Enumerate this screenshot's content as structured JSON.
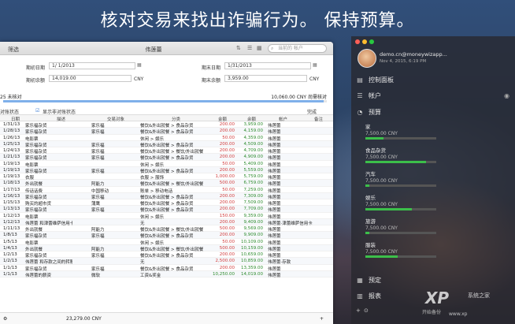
{
  "headline": "核对交易来找出诈骗行为。 保持预算。",
  "window": {
    "filter_label": "筛选",
    "title": "伟莲蕾",
    "search_placeholder": "当前的 帐户",
    "form": {
      "start_date_label": "期初日期",
      "start_date": "1/ 1/2013",
      "end_date_label": "期末日期",
      "end_date": "1/31/2013",
      "opening_balance_label": "期初余额",
      "opening_balance": "14,019.00",
      "opening_currency": "CNY",
      "closing_balance_label": "期末余额",
      "closing_balance": "3,959.00",
      "closing_currency": "CNY"
    },
    "progress": {
      "left_text": "25 未核对",
      "right_text": "10,060.00 CNY 尚需核对",
      "fraction": 0.99
    },
    "filter_row": {
      "left": "对账状态",
      "option": "显示非对账状态",
      "done": "完成"
    },
    "columns": [
      "日期",
      "描述",
      "交易对象",
      "分类",
      "金额",
      "余额",
      "帐户",
      "备注"
    ],
    "rows": [
      [
        "1/31/13",
        "家乐福杂货",
        "家乐福",
        "餐饮&外出就餐 > 食品杂货",
        "200.00",
        "3,959.00",
        "伟莲蕾",
        ""
      ],
      [
        "1/28/13",
        "家乐福杂货",
        "家乐福",
        "餐饮&外出就餐 > 食品杂货",
        "200.00",
        "4,159.00",
        "伟莲蕾",
        ""
      ],
      [
        "1/26/13",
        "电影票",
        "",
        "休闲 > 娱乐",
        "50.00",
        "4,359.00",
        "伟莲蕾",
        ""
      ],
      [
        "1/25/13",
        "家乐福杂货",
        "家乐福",
        "餐饮&外出就餐 > 食品杂货",
        "200.00",
        "4,509.00",
        "伟莲蕾",
        ""
      ],
      [
        "1/24/13",
        "家乐福杂货",
        "家乐福",
        "餐饮&外出就餐 > 餐饮/外出就餐",
        "200.00",
        "4,709.00",
        "伟莲蕾",
        ""
      ],
      [
        "1/21/13",
        "家乐福杂货",
        "家乐福",
        "餐饮&外出就餐 > 食品杂货",
        "200.00",
        "4,909.00",
        "伟莲蕾",
        ""
      ],
      [
        "1/19/13",
        "电影票",
        "",
        "休闲 > 娱乐",
        "50.00",
        "5,409.00",
        "伟莲蕾",
        ""
      ],
      [
        "1/19/13",
        "家乐福杂货",
        "家乐福",
        "餐饮&外出就餐 > 食品杂货",
        "200.00",
        "5,559.00",
        "伟莲蕾",
        ""
      ],
      [
        "1/19/13",
        "衣服",
        "",
        "衣服 > 服饰",
        "1,000.00",
        "5,759.00",
        "伟莲蕾",
        ""
      ],
      [
        "1/18/13",
        "外出就餐",
        "阿能力",
        "餐饮&外出就餐 > 餐饮/外出就餐",
        "500.00",
        "6,759.00",
        "伟莲蕾",
        ""
      ],
      [
        "1/17/13",
        "传话话费",
        "中国移动",
        "账单 > 移动电话",
        "50.00",
        "7,259.00",
        "伟莲蕾",
        ""
      ],
      [
        "1/16/13",
        "家乐福杂货",
        "家乐福",
        "餐饮&外出就餐 > 食品杂货",
        "200.00",
        "7,309.00",
        "伟莲蕾",
        ""
      ],
      [
        "1/15/13",
        "购买的超市货",
        "蒲鹰",
        "餐饮&外出就餐 > 食品杂货",
        "200.00",
        "7,509.00",
        "伟莲蕾",
        ""
      ],
      [
        "1/13/13",
        "家乐福杂货",
        "家乐福",
        "餐饮&外出就餐 > 食品杂货",
        "200.00",
        "7,709.00",
        "伟莲蕾",
        ""
      ],
      [
        "1/12/13",
        "电影票",
        "",
        "休闲 > 娱乐",
        "150.00",
        "9,359.00",
        "伟莲蕾",
        ""
      ],
      [
        "1/12/13",
        "伟莲蕾 和津蕾维萨信用卡之间...",
        "",
        "无",
        "200.00",
        "9,409.00",
        "伟莲蕾·津蕾维萨信用卡",
        ""
      ],
      [
        "1/11/13",
        "外出就餐",
        "阿能力",
        "餐饮&外出就餐 > 餐饮/外出就餐",
        "500.00",
        "9,569.00",
        "伟莲蕾",
        ""
      ],
      [
        "1/8/13",
        "家乐福杂货",
        "家乐福",
        "餐饮&外出就餐 > 食品杂货",
        "200.00",
        "9,909.00",
        "伟莲蕾",
        ""
      ],
      [
        "1/5/13",
        "电影票",
        "",
        "休闲 > 娱乐",
        "50.00",
        "10,109.00",
        "伟莲蕾",
        ""
      ],
      [
        "1/4/13",
        "外出就餐",
        "阿能力",
        "餐饮&外出就餐 > 餐饮/外出就餐",
        "500.00",
        "10,159.00",
        "伟莲蕾",
        ""
      ],
      [
        "1/2/13",
        "家乐福杂货",
        "家乐福",
        "餐饮&外出就餐 > 食品杂货",
        "200.00",
        "10,659.00",
        "伟莲蕾",
        ""
      ],
      [
        "1/2/13",
        "伟莲蕾 和存款之间的转账",
        "",
        "无",
        "2,500.00",
        "10,859.00",
        "伟莲蕾·存款",
        ""
      ],
      [
        "1/1/13",
        "家乐福杂货",
        "家乐福",
        "餐饮&外出就餐 > 食品杂货",
        "200.00",
        "13,359.00",
        "伟莲蕾",
        ""
      ],
      [
        "1/1/13",
        "伟莲蕾的薪资",
        "微软",
        "工资&奖金",
        "10,250.00",
        "14,019.00",
        "伟莲蕾",
        ""
      ]
    ],
    "footer_total": "23,279.00 CNY"
  },
  "sidebar": {
    "email": "demo.cn@moneywizapp...",
    "date": "Nov 4, 2015, 6:19 PM",
    "nav": {
      "dashboard": "控制面板",
      "accounts": "帐户",
      "budgets": "预算",
      "scheduled": "预定",
      "reports": "报表"
    },
    "budgets": [
      {
        "name": "家",
        "value": "7,500.00 CNY",
        "fraction": 0.25,
        "color": "#3cbf4a"
      },
      {
        "name": "食品杂货",
        "value": "7,500.00 CNY",
        "fraction": 0.85,
        "color": "#3cbf4a"
      },
      {
        "name": "汽车",
        "value": "7,500.00 CNY",
        "fraction": 0.05,
        "color": "#3cbf4a"
      },
      {
        "name": "娱乐",
        "value": "7,500.00 CNY",
        "fraction": 0.65,
        "color": "#3cbf4a"
      },
      {
        "name": "旅游",
        "value": "7,500.00 CNY",
        "fraction": 0.05,
        "color": "#3cbf4a"
      },
      {
        "name": "服装",
        "value": "7,500.00 CNY",
        "fraction": 0.45,
        "color": "#3cbf4a"
      }
    ],
    "bottom_label": "开始备份"
  },
  "watermark": {
    "logo": "XP",
    "text": "系统之家",
    "url": "www.xp"
  },
  "colors": {
    "expense": "#d23c3c",
    "balance": "#2e8b2e",
    "accent": "#7fb0ea"
  }
}
